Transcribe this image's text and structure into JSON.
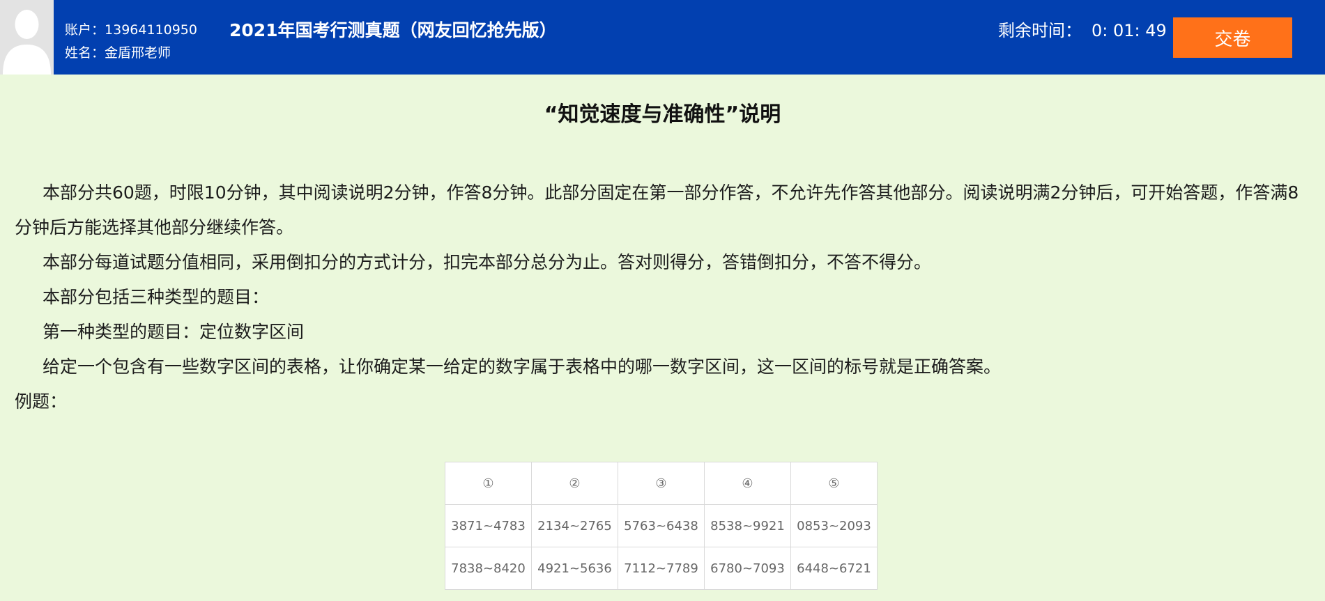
{
  "header": {
    "account_label": "账户：",
    "account_value": "13964110950",
    "name_label": "姓名：",
    "name_value": "金盾邢老师",
    "exam_title": "2021年国考行测真题（网友回忆抢先版）",
    "timer_label": "剩余时间：",
    "timer_value": "0: 01: 49",
    "submit_label": "交卷"
  },
  "section": {
    "title": "“知觉速度与准确性”说明",
    "paragraphs": [
      "本部分共60题，时限10分钟，其中阅读说明2分钟，作答8分钟。此部分固定在第一部分作答，不允许先作答其他部分。阅读说明满2分钟后，可开始答题，作答满8分钟后方能选择其他部分继续作答。",
      "本部分每道试题分值相同，采用倒扣分的方式计分，扣完本部分总分为止。答对则得分，答错倒扣分，不答不得分。",
      "本部分包括三种类型的题目：",
      "第一种类型的题目：定位数字区间",
      "给定一个包含有一些数字区间的表格，让你确定某一给定的数字属于表格中的哪一数字区间，这一区间的标号就是正确答案。"
    ],
    "example_label": "例题："
  },
  "example_table": {
    "headers": [
      "①",
      "②",
      "③",
      "④",
      "⑤"
    ],
    "rows": [
      [
        "3871~4783",
        "2134~2765",
        "5763~6438",
        "8538~9921",
        "0853~2093"
      ],
      [
        "7838~8420",
        "4921~5636",
        "7112~7789",
        "6780~7093",
        "6448~6721"
      ]
    ]
  },
  "colors": {
    "header_bg": "#0240b0",
    "page_bg": "#ebf8dc",
    "submit_bg": "#ff7119"
  }
}
